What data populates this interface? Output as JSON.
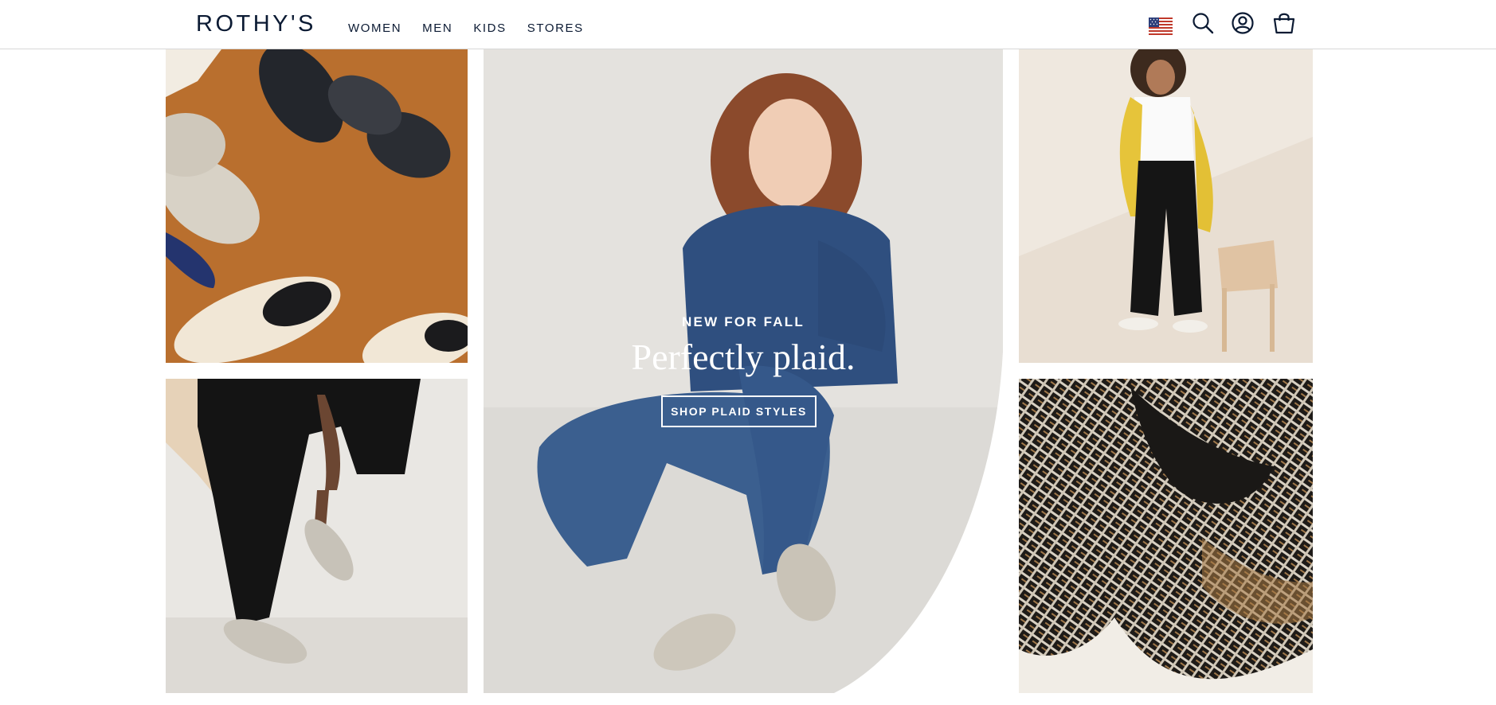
{
  "brand": {
    "logo_text": "ROTHY'S"
  },
  "nav": {
    "items": [
      {
        "label": "WOMEN"
      },
      {
        "label": "MEN"
      },
      {
        "label": "KIDS"
      },
      {
        "label": "STORES"
      }
    ]
  },
  "header_icons": {
    "flag": "us-flag-icon",
    "search": "search-icon",
    "account": "account-icon",
    "bag": "shopping-bag-icon"
  },
  "hero": {
    "eyebrow": "NEW FOR FALL",
    "headline": "Perfectly plaid.",
    "cta_label": "SHOP PLAID STYLES"
  },
  "colors": {
    "brand_navy": "#0b1a33",
    "white": "#ffffff",
    "tile_orange": "#b9702f",
    "denim": "#2f4f7f"
  }
}
